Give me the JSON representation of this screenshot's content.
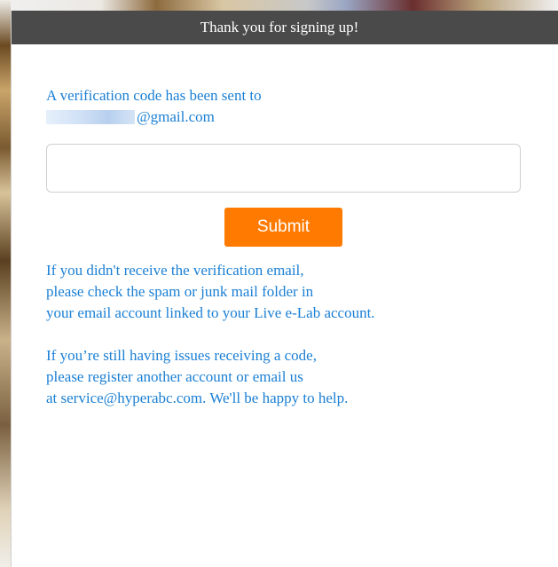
{
  "dialog": {
    "title": "Thank you for signing up!",
    "sent_message": "A verification code has been sent to",
    "email_domain": "@gmail.com",
    "code_input": {
      "value": "",
      "placeholder": ""
    },
    "submit_label": "Submit",
    "help_paragraph_1": [
      "If you didn't receive the verification email,",
      "please check the spam or junk mail folder in",
      "your email account linked to your Live e-Lab account."
    ],
    "help_paragraph_2": [
      "If you’re still having issues receiving a code,",
      "please register another account or email us",
      "at service@hyperabc.com. We'll be happy to help."
    ]
  },
  "colors": {
    "header_bg": "#4a4a4a",
    "text_blue": "#1a7fd4",
    "submit_orange": "#ff7a00"
  }
}
